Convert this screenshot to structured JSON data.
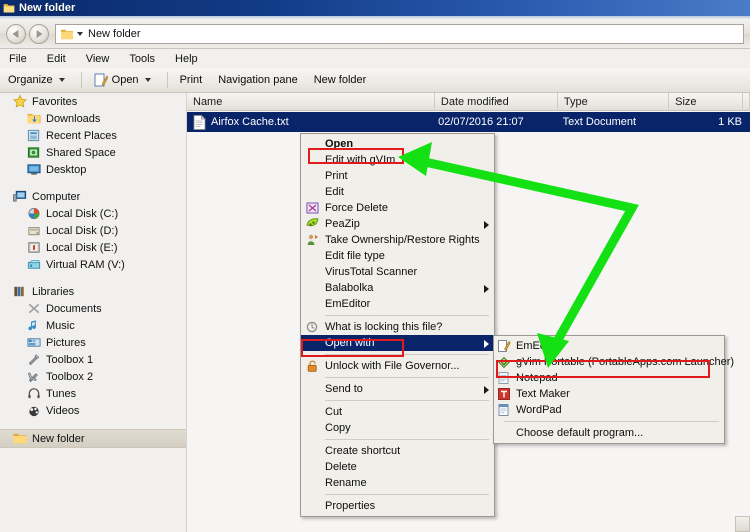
{
  "window": {
    "title": "New folder",
    "title_icon": "folder-icon"
  },
  "addressbar": {
    "back_icon": "back-arrow-icon",
    "forward_icon": "forward-arrow-icon",
    "folder_icon": "folder-icon",
    "dropdown_icon": "chevron-down-icon",
    "path": "New folder"
  },
  "menubar": {
    "items": [
      {
        "label": "File"
      },
      {
        "label": "Edit"
      },
      {
        "label": "View"
      },
      {
        "label": "Tools"
      },
      {
        "label": "Help"
      }
    ]
  },
  "commandbar": {
    "organize": "Organize",
    "open": "Open",
    "open_icon": "open-file-icon",
    "print": "Print",
    "navigation_pane": "Navigation pane",
    "new_folder": "New folder"
  },
  "navpane": {
    "groups": [
      {
        "header": {
          "label": "Favorites",
          "icon": "star-icon"
        },
        "items": [
          {
            "label": "Downloads",
            "icon": "downloads-folder-icon"
          },
          {
            "label": "Recent Places",
            "icon": "recent-places-icon"
          },
          {
            "label": "Shared Space",
            "icon": "shared-space-icon"
          },
          {
            "label": "Desktop",
            "icon": "desktop-icon"
          }
        ]
      },
      {
        "header": {
          "label": "Computer",
          "icon": "computer-icon"
        },
        "items": [
          {
            "label": "Local Disk (C:)",
            "icon": "system-drive-icon"
          },
          {
            "label": "Local Disk (D:)",
            "icon": "drive-icon"
          },
          {
            "label": "Local Disk (E:)",
            "icon": "drive-icon"
          },
          {
            "label": "Virtual RAM (V:)",
            "icon": "ramdisk-icon"
          }
        ]
      },
      {
        "header": {
          "label": "Libraries",
          "icon": "libraries-icon"
        },
        "items": [
          {
            "label": "Documents",
            "icon": "documents-library-icon"
          },
          {
            "label": "Music",
            "icon": "music-library-icon"
          },
          {
            "label": "Pictures",
            "icon": "pictures-library-icon"
          },
          {
            "label": "Toolbox 1",
            "icon": "toolbox-icon"
          },
          {
            "label": "Toolbox 2",
            "icon": "toolbox-icon"
          },
          {
            "label": "Tunes",
            "icon": "headphones-icon"
          },
          {
            "label": "Videos",
            "icon": "videos-library-icon"
          }
        ]
      }
    ],
    "selected": {
      "label": "New folder",
      "icon": "folder-icon"
    }
  },
  "filelist": {
    "columns": [
      {
        "label": "Name",
        "sorted": false
      },
      {
        "label": "Date modified",
        "sorted": true
      },
      {
        "label": "Type",
        "sorted": false
      },
      {
        "label": "Size",
        "sorted": false
      }
    ],
    "rows": [
      {
        "icon": "text-file-icon",
        "name": "Airfox Cache.txt",
        "date_modified": "02/07/2016 21:07",
        "type": "Text Document",
        "size": "1 KB",
        "selected": true
      }
    ]
  },
  "context_menu": {
    "items": [
      {
        "label": "Open",
        "bold": true,
        "icon": null,
        "submenu": false
      },
      {
        "label": "Edit with gVIm",
        "bold": false,
        "icon": null,
        "submenu": false,
        "highlight_box": true
      },
      {
        "label": "Print",
        "bold": false,
        "icon": null,
        "submenu": false
      },
      {
        "label": "Edit",
        "bold": false,
        "icon": null,
        "submenu": false
      },
      {
        "label": "Force Delete",
        "bold": false,
        "icon": "force-delete-icon",
        "submenu": false
      },
      {
        "label": "PeaZip",
        "bold": false,
        "icon": "peazip-icon",
        "submenu": true
      },
      {
        "label": "Take Ownership/Restore Rights",
        "bold": false,
        "icon": "take-ownership-icon",
        "submenu": false
      },
      {
        "label": "Edit file type",
        "bold": false,
        "icon": null,
        "submenu": false
      },
      {
        "label": "VirusTotal Scanner",
        "bold": false,
        "icon": null,
        "submenu": false
      },
      {
        "label": "Balabolka",
        "bold": false,
        "icon": null,
        "submenu": true
      },
      {
        "label": "EmEditor",
        "bold": false,
        "icon": null,
        "submenu": false
      },
      {
        "separator": true
      },
      {
        "label": "What is locking this file?",
        "bold": false,
        "icon": "locking-icon",
        "submenu": false
      },
      {
        "label": "Open with",
        "bold": false,
        "icon": null,
        "submenu": true,
        "selected": true,
        "highlight_box": true
      },
      {
        "separator": true
      },
      {
        "label": "Unlock with File Governor...",
        "bold": false,
        "icon": "padlock-icon",
        "submenu": false
      },
      {
        "separator": true
      },
      {
        "label": "Send to",
        "bold": false,
        "icon": null,
        "submenu": true
      },
      {
        "separator": true
      },
      {
        "label": "Cut",
        "bold": false,
        "icon": null,
        "submenu": false
      },
      {
        "label": "Copy",
        "bold": false,
        "icon": null,
        "submenu": false
      },
      {
        "separator": true
      },
      {
        "label": "Create shortcut",
        "bold": false,
        "icon": null,
        "submenu": false
      },
      {
        "label": "Delete",
        "bold": false,
        "icon": null,
        "submenu": false
      },
      {
        "label": "Rename",
        "bold": false,
        "icon": null,
        "submenu": false
      },
      {
        "separator": true
      },
      {
        "label": "Properties",
        "bold": false,
        "icon": null,
        "submenu": false
      }
    ]
  },
  "open_with_submenu": {
    "items": [
      {
        "label": "EmEditor",
        "icon": "emeditor-icon"
      },
      {
        "label": "gVim Portable (PortableApps.com Launcher)",
        "icon": "gvim-icon",
        "highlight_box": true
      },
      {
        "label": "Notepad",
        "icon": "notepad-icon"
      },
      {
        "label": "Text Maker",
        "icon": "textmaker-icon"
      },
      {
        "label": "WordPad",
        "icon": "wordpad-icon"
      },
      {
        "separator": true
      },
      {
        "label": "Choose default program...",
        "icon": null
      }
    ]
  },
  "annotations": {
    "arrow_color": "#14e114",
    "highlight_color": "#e01b1b"
  }
}
